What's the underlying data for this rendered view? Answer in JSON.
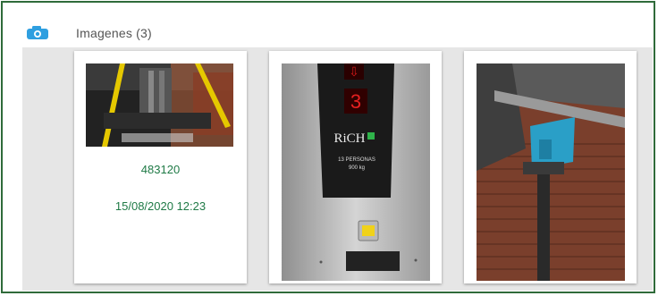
{
  "section": {
    "title": "Imagenes (3)",
    "icon": "camera-icon",
    "accent": "#2f9fe0",
    "border_color": "#2f6b3a"
  },
  "images": [
    {
      "id_text": "483120",
      "datetime": "15/08/2020 12:23",
      "alt": "elevator machinery"
    },
    {
      "alt": "elevator panel"
    },
    {
      "alt": "elevator shaft"
    }
  ],
  "panel_text": {
    "brand": "RiCH",
    "line1": "13 PERSONAS",
    "line2": "900 kg",
    "floor": "3"
  }
}
